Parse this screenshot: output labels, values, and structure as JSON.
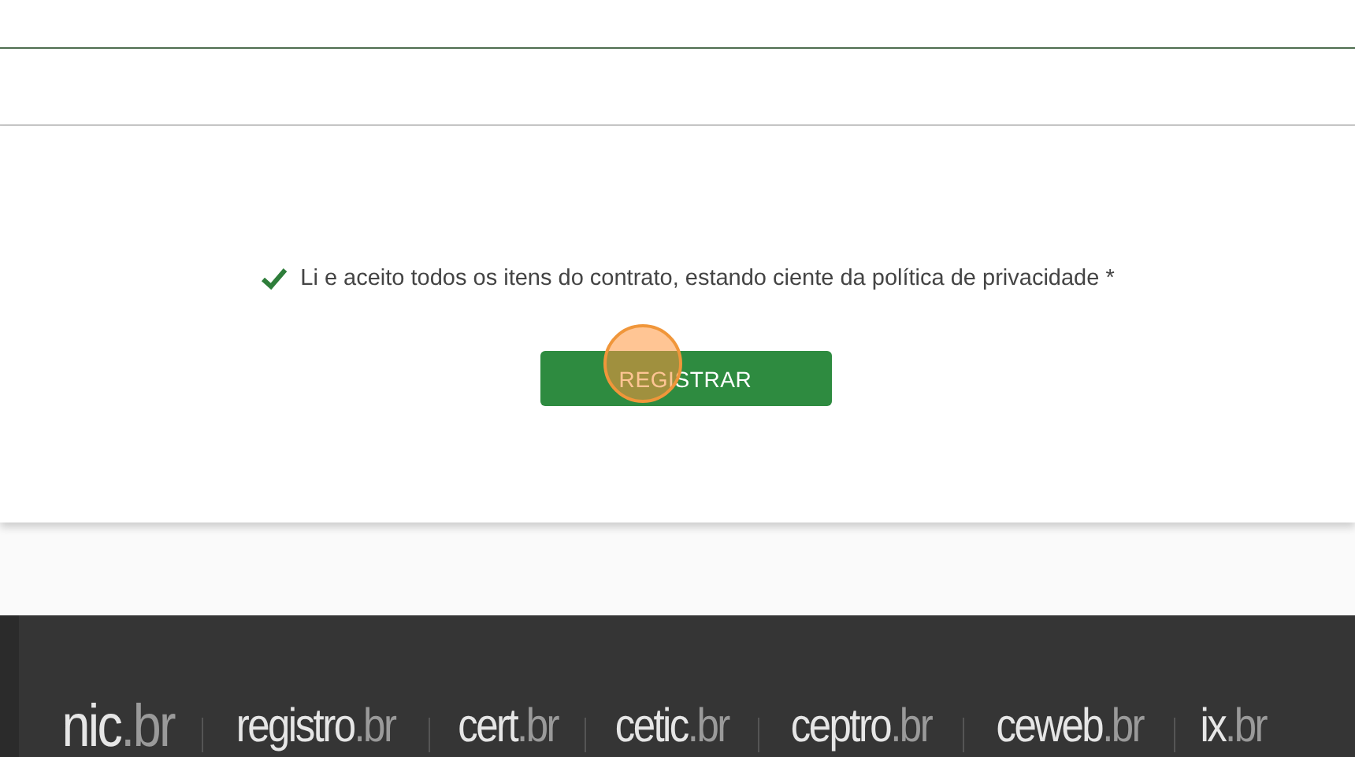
{
  "agreement": {
    "checked": true,
    "label": "Li e aceito todos os itens do contrato, estando ciente da política de privacidade *"
  },
  "register_button": {
    "label": "REGISTRAR"
  },
  "click_marker": {
    "kind": "circle"
  },
  "footer": {
    "logos": [
      {
        "name": "nic",
        "suffix": ".br"
      },
      {
        "name": "registro",
        "suffix": ".br"
      },
      {
        "name": "cert",
        "suffix": ".br"
      },
      {
        "name": "cetic",
        "suffix": ".br"
      },
      {
        "name": "ceptro",
        "suffix": ".br"
      },
      {
        "name": "ceweb",
        "suffix": ".br"
      },
      {
        "name": "ix",
        "suffix": ".br"
      }
    ]
  }
}
